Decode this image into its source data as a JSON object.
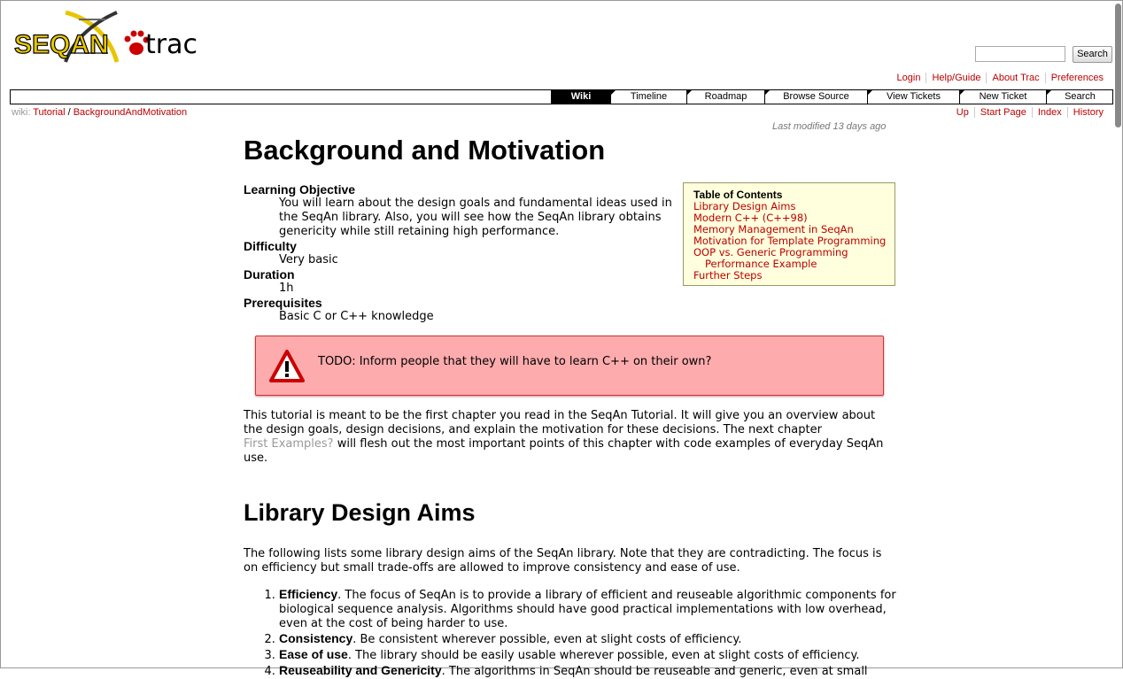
{
  "header": {
    "logo_seqan": "SEQAN",
    "logo_trac": "trac",
    "search_button": "Search"
  },
  "metanav": [
    "Login",
    "Help/Guide",
    "About Trac",
    "Preferences"
  ],
  "mainnav": [
    "Wiki",
    "Timeline",
    "Roadmap",
    "Browse Source",
    "View Tickets",
    "New Ticket",
    "Search"
  ],
  "breadcrumb": {
    "label": "wiki:",
    "parent": "Tutorial",
    "sep": "/",
    "current": "BackgroundAndMotivation"
  },
  "ctxnav": [
    "Up",
    "Start Page",
    "Index",
    "History"
  ],
  "last_modified": "Last modified 13 days ago",
  "page_title": "Background and Motivation",
  "deflist": [
    {
      "term": "Learning Objective",
      "desc": "You will learn about the design goals and fundamental ideas used in the SeqAn library. Also, you will see how the SeqAn library obtains genericity while still retaining high performance."
    },
    {
      "term": "Difficulty",
      "desc": "Very basic"
    },
    {
      "term": "Duration",
      "desc": "1h"
    },
    {
      "term": "Prerequisites",
      "desc": "Basic C or C++ knowledge"
    }
  ],
  "toc": {
    "title": "Table of Contents",
    "items": [
      "Library Design Aims",
      "Modern C++ (C++98)",
      "Memory Management in SeqAn",
      "Motivation for Template Programming",
      "OOP vs. Generic Programming"
    ],
    "subitem": "Performance Example",
    "last": "Further Steps"
  },
  "todo": "TODO: Inform people that they will have to learn C++ on their own?",
  "intro": {
    "before": "This tutorial is meant to be the first chapter you read in the SeqAn Tutorial. It will give you an overview about the design goals, design decisions, and explain the motivation for these decisions. The next chapter",
    "link": "First Examples?",
    "after": "will flesh out the most important points of this chapter with code examples of everyday SeqAn use."
  },
  "section_heading": "Library Design Aims",
  "section_intro": "The following lists some library design aims of the SeqAn library. Note that they are contradicting. The focus is on efficiency but small trade-offs are allowed to improve consistency and ease of use.",
  "aims": [
    {
      "term": "Efficiency",
      "text": ". The focus of SeqAn is to provide a library of efficient and reuseable algorithmic components for biological sequence analysis. Algorithms should have good practical implementations with low overhead, even at the cost of being harder to use."
    },
    {
      "term": "Consistency",
      "text": ". Be consistent wherever possible, even at slight costs of efficiency."
    },
    {
      "term": "Ease of use",
      "text": ". The library should be easily usable wherever possible, even at slight costs of efficiency."
    },
    {
      "term": "Reuseability and Genericity",
      "text": ". The algorithms in SeqAn should be reuseable and generic, even at small"
    }
  ],
  "colors": {
    "link": "#bb0000",
    "todo_bg": "#fdabad",
    "toc_bg": "#ffffdd"
  }
}
